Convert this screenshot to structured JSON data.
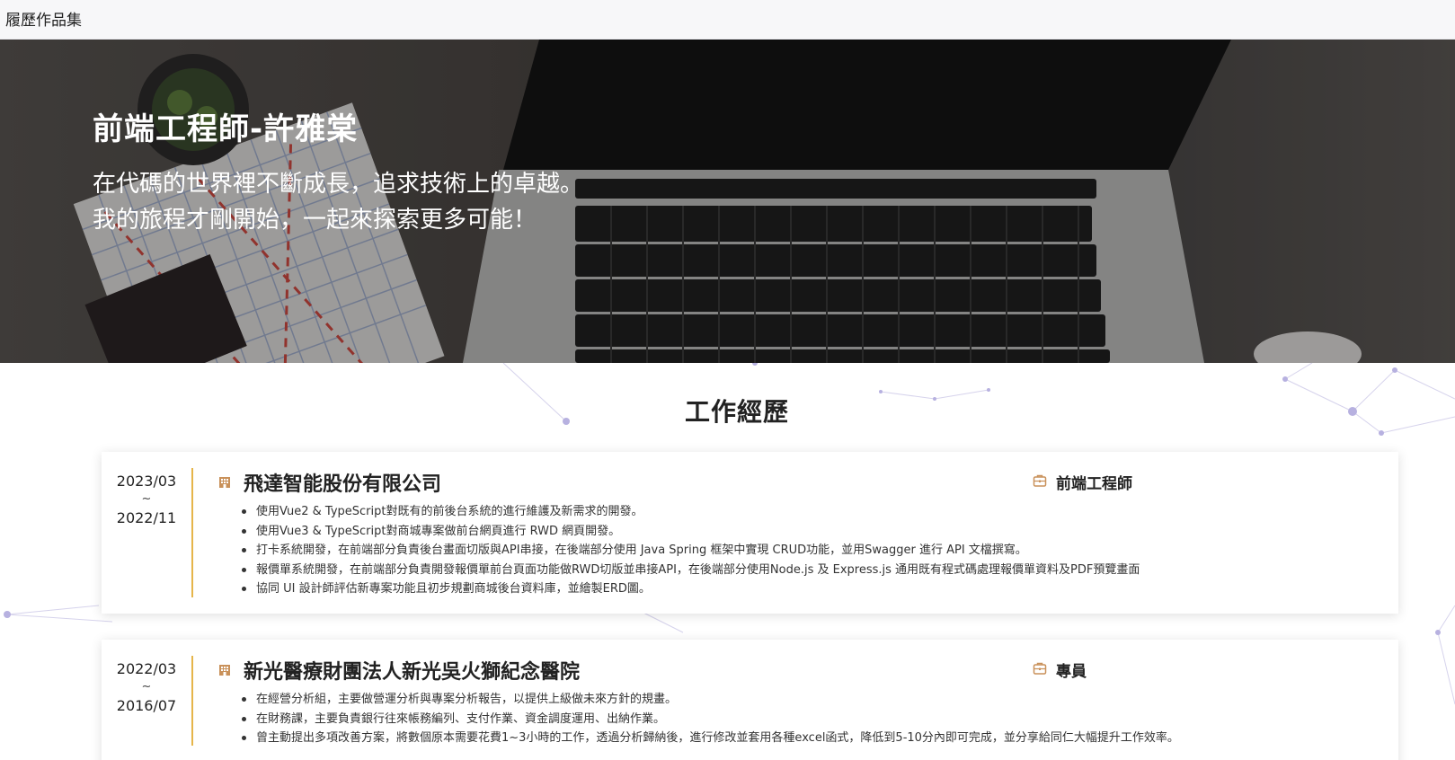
{
  "nav": {
    "brand": "履歷作品集"
  },
  "hero": {
    "title": "前端工程師-許雅棠",
    "subtitle_line1": "在代碼的世界裡不斷成長，追求技術上的卓越。",
    "subtitle_line2": "我的旅程才剛開始，一起來探索更多可能！"
  },
  "experience": {
    "section_title": "工作經歷",
    "jobs": [
      {
        "date_end": "2023/03",
        "separator": "~",
        "date_start": "2022/11",
        "company": "飛達智能股份有限公司",
        "role": "前端工程師",
        "duties": [
          "使用Vue2 & TypeScript對既有的前後台系統的進行維護及新需求的開發。",
          "使用Vue3 & TypeScript對商城專案做前台網頁進行 RWD 網頁開發。",
          "打卡系統開發，在前端部分負責後台畫面切版與API串接，在後端部分使用 Java Spring 框架中實現 CRUD功能，並用Swagger 進行 API 文檔撰寫。",
          "報價單系統開發，在前端部分負責開發報價單前台頁面功能做RWD切版並串接API，在後端部分使用Node.js 及 Express.js 通用既有程式碼處理報價單資料及PDF預覽畫面",
          "協同 UI 設計師評估新專案功能且初步規劃商城後台資料庫，並繪製ERD圖。"
        ]
      },
      {
        "date_end": "2022/03",
        "separator": "~",
        "date_start": "2016/07",
        "company": "新光醫療財團法人新光吳火獅紀念醫院",
        "role": "專員",
        "duties": [
          "在經營分析組，主要做營運分析與專案分析報告，以提供上級做未來方針的規畫。",
          "在財務課，主要負責銀行往來帳務編列、支付作業、資金調度運用、出納作業。",
          "曾主動提出多項改善方案，將數個原本需要花費1~3小時的工作，透過分析歸納後，進行修改並套用各種excel函式，降低到5-10分內即可完成，並分享給同仁大幅提升工作效率。"
        ]
      }
    ]
  },
  "colors": {
    "accent": "#e6b54a",
    "icon": "#c9915a",
    "network": "#a9a3d8"
  },
  "icons": {
    "company": "building-icon",
    "role": "briefcase-icon"
  }
}
